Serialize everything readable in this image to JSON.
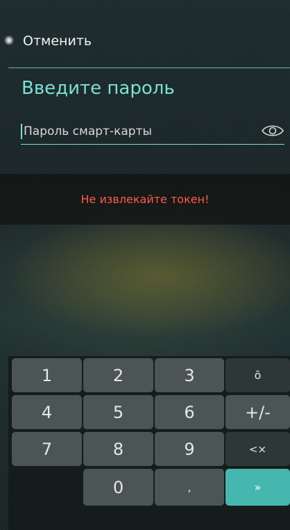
{
  "header": {
    "cancel_label": "Отменить"
  },
  "title": "Введите пароль",
  "password_field": {
    "placeholder": "Пароль смарт-карты",
    "value": ""
  },
  "warning": "Не извлекайте токен!",
  "keyboard": {
    "keys": [
      "1",
      "2",
      "3",
      "ō",
      "4",
      "5",
      "6",
      "+/-",
      "7",
      "8",
      "9",
      "<×",
      "0",
      ",",
      "»"
    ]
  },
  "colors": {
    "accent": "#7ce0d6",
    "warning": "#ff5a4a",
    "submit": "#46b7ae"
  },
  "icons": {
    "eye": "eye-icon"
  }
}
